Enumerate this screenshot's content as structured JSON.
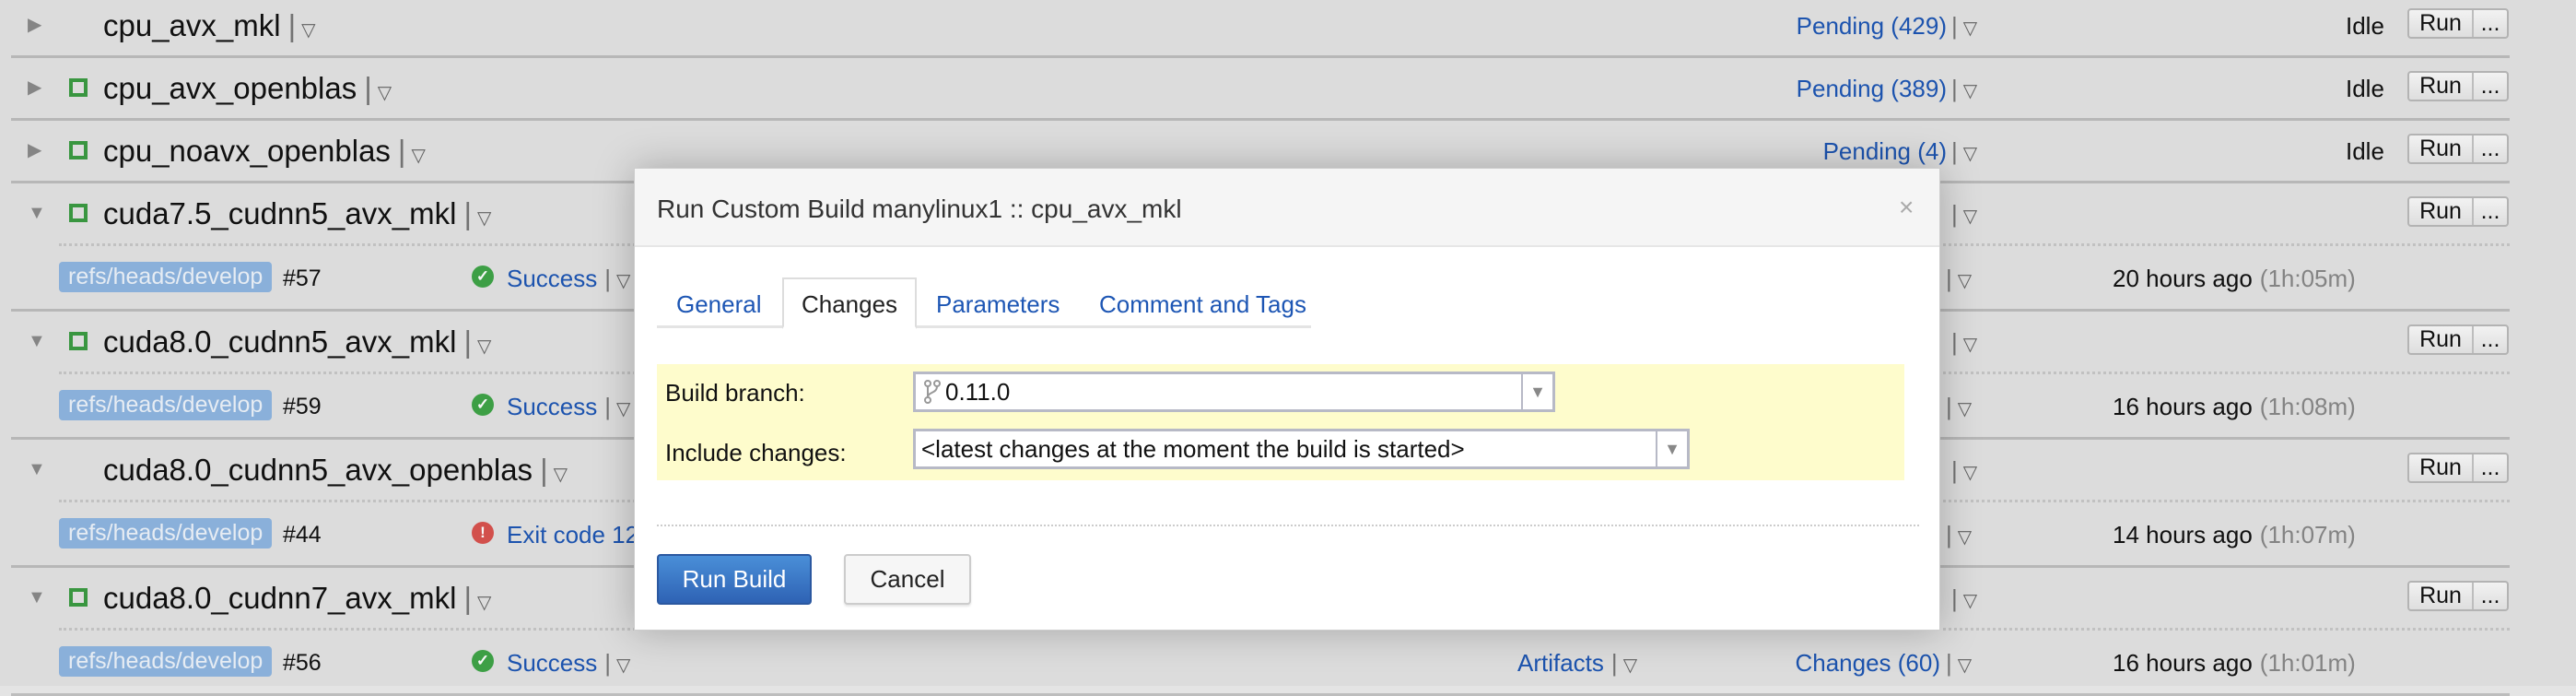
{
  "configurations": [
    {
      "name": "cpu_avx_mkl",
      "status": "failed",
      "expanded": false,
      "pending": "Pending (429)",
      "state": "Idle"
    },
    {
      "name": "cpu_avx_openblas",
      "status": "ok",
      "expanded": false,
      "pending": "Pending (389)",
      "state": "Idle"
    },
    {
      "name": "cpu_noavx_openblas",
      "status": "ok",
      "expanded": false,
      "pending": "Pending (4)",
      "state": "Idle"
    },
    {
      "name": "cuda7.5_cudnn5_avx_mkl",
      "status": "ok",
      "expanded": true,
      "build": {
        "branch": "refs/heads/develop",
        "number": "#57",
        "result": "Success",
        "result_status": "success",
        "time": "20 hours ago",
        "duration": "(1h:05m)"
      }
    },
    {
      "name": "cuda8.0_cudnn5_avx_mkl",
      "status": "ok",
      "expanded": true,
      "build": {
        "branch": "refs/heads/develop",
        "number": "#59",
        "result": "Success",
        "result_status": "success",
        "time": "16 hours ago",
        "duration": "(1h:08m)"
      }
    },
    {
      "name": "cuda8.0_cudnn5_avx_openblas",
      "status": "failed",
      "expanded": true,
      "build": {
        "branch": "refs/heads/develop",
        "number": "#44",
        "result": "Exit code 12",
        "result_status": "error",
        "time": "14 hours ago",
        "duration": "(1h:07m)"
      }
    },
    {
      "name": "cuda8.0_cudnn7_avx_mkl",
      "status": "ok",
      "expanded": true,
      "build": {
        "branch": "refs/heads/develop",
        "number": "#56",
        "result": "Success",
        "result_status": "success",
        "artifacts": "Artifacts",
        "changes": "Changes (60)",
        "time": "16 hours ago",
        "duration": "(1h:01m)"
      }
    }
  ],
  "run_button": {
    "label": "Run",
    "more": "..."
  },
  "colors": {
    "failed": "#dd5e4f",
    "ok": "#3b9b43",
    "link": "#1d56b4",
    "success_icon": "#3fa548",
    "error_icon": "#d9534f",
    "badge": "#8fb6e2"
  },
  "dialog": {
    "title": "Run Custom Build manylinux1 :: cpu_avx_mkl",
    "close": "×",
    "tabs": [
      {
        "label": "General"
      },
      {
        "label": "Changes",
        "active": true
      },
      {
        "label": "Parameters"
      },
      {
        "label": "Comment and Tags"
      }
    ],
    "build_branch_label": "Build branch:",
    "build_branch_value": "0.11.0",
    "include_changes_label": "Include changes:",
    "include_changes_value": "<latest changes at the moment the build is started>",
    "run_build": "Run Build",
    "cancel": "Cancel"
  }
}
